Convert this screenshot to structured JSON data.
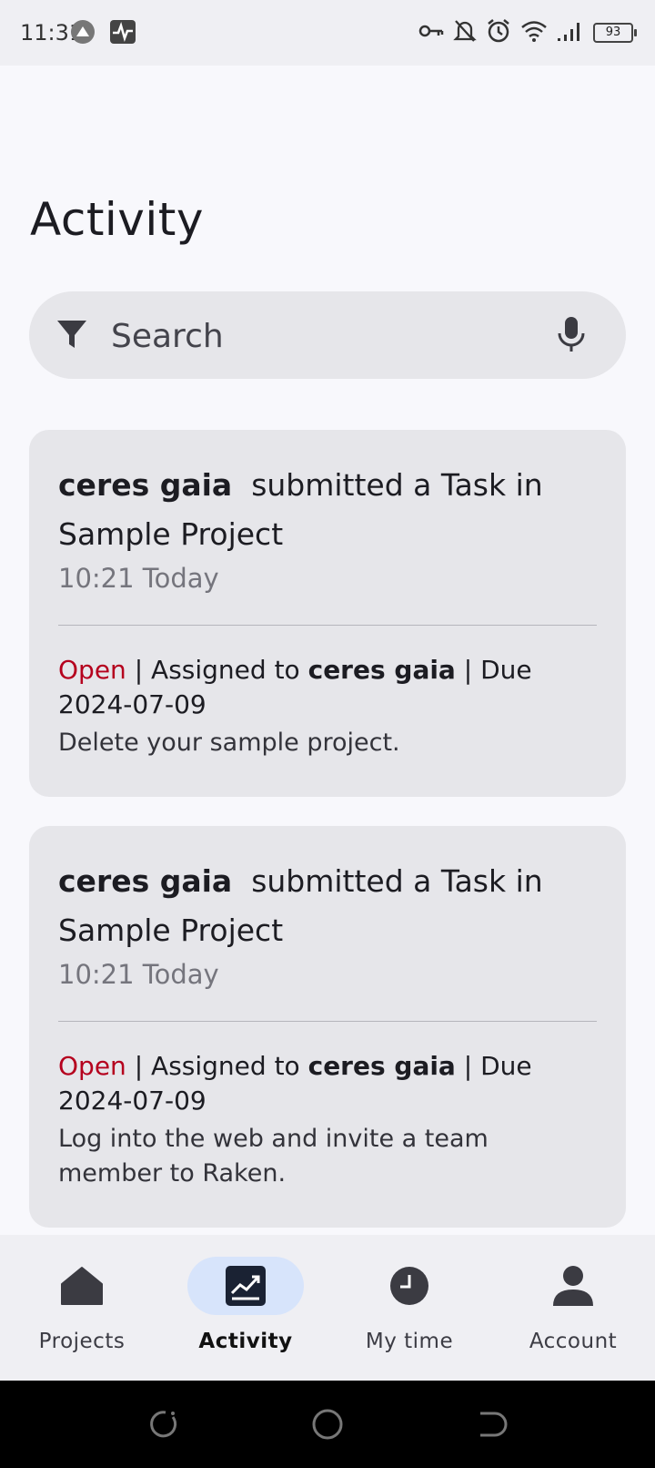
{
  "status_bar": {
    "time": "11:31",
    "battery": "93"
  },
  "page": {
    "title": "Activity"
  },
  "search": {
    "placeholder": "Search"
  },
  "cards": [
    {
      "user": "ceres gaia",
      "action": "submitted a Task in",
      "project": "Sample Project",
      "time": "10:21 Today",
      "status": "Open",
      "assigned_prefix": "| Assigned to",
      "assignee": "ceres gaia",
      "due": "| Due 2024-07-09",
      "description": "Delete your sample project."
    },
    {
      "user": "ceres gaia",
      "action": "submitted a Task in",
      "project": "Sample Project",
      "time": "10:21 Today",
      "status": "Open",
      "assigned_prefix": "| Assigned to",
      "assignee": "ceres gaia",
      "due": "| Due 2024-07-09",
      "description": "Log into the web and invite a team member to Raken."
    }
  ],
  "bottom_nav": {
    "items": [
      {
        "label": "Projects",
        "icon": "home-icon"
      },
      {
        "label": "Activity",
        "icon": "activity-chart-icon",
        "active": true
      },
      {
        "label": "My time",
        "icon": "clock-icon"
      },
      {
        "label": "Account",
        "icon": "person-icon"
      }
    ]
  },
  "colors": {
    "accent_status": "#b5001e",
    "active_pill": "#d7e4fb"
  }
}
